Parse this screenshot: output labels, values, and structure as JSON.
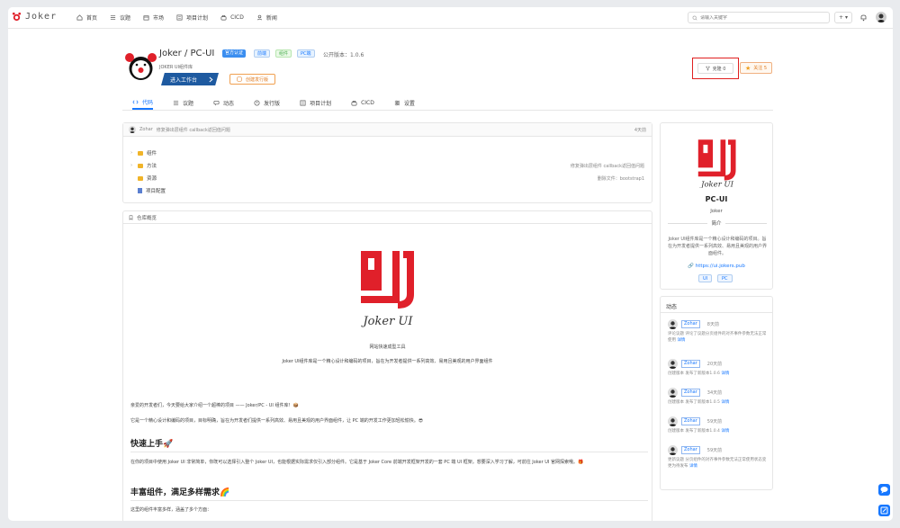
{
  "app": {
    "name": "Joker"
  },
  "nav": [
    {
      "label": "首页",
      "icon": "home-icon"
    },
    {
      "label": "议题",
      "icon": "list-icon"
    },
    {
      "label": "市场",
      "icon": "store-icon"
    },
    {
      "label": "项目计划",
      "icon": "plan-icon"
    },
    {
      "label": "CICD",
      "icon": "cicd-icon"
    },
    {
      "label": "新闻",
      "icon": "user-icon"
    }
  ],
  "search": {
    "placeholder": "请输入关键字"
  },
  "topbar": {
    "plus": "+ ▾"
  },
  "project": {
    "title": "Joker / PC-UI",
    "badges": [
      {
        "label": "官方认证",
        "bg": "#3b8ef0",
        "fg": "#ffffff"
      },
      {
        "label": "前端",
        "bg": "#e6f2ff",
        "fg": "#1677ff"
      },
      {
        "label": "组件",
        "bg": "#e9f9e6",
        "fg": "#4caf50"
      },
      {
        "label": "PC端",
        "bg": "#e6f2ff",
        "fg": "#1677ff"
      }
    ],
    "version": "公开版本：1.0.6",
    "desc": "JOKER UI组件库",
    "enter": "进入工作台",
    "release": "创建发行版",
    "clone": "克隆 0",
    "follow": "关注 5"
  },
  "tabs": [
    {
      "label": "代码",
      "icon": "code-icon"
    },
    {
      "label": "议题",
      "icon": "list-icon"
    },
    {
      "label": "动态",
      "icon": "chat-icon"
    },
    {
      "label": "发行版",
      "icon": "release-icon"
    },
    {
      "label": "项目计划",
      "icon": "plan-icon"
    },
    {
      "label": "CICD",
      "icon": "cicd-icon"
    },
    {
      "label": "设置",
      "icon": "settings-icon"
    }
  ],
  "commit": {
    "author": "Zohar",
    "message": "修复弹出层组件 callback返回值问题",
    "time": "4天前"
  },
  "files": [
    {
      "name": "组件",
      "type": "folder",
      "msg": ""
    },
    {
      "name": "方法",
      "type": "folder",
      "msg": "修复弹出层组件 callback返回值问题"
    },
    {
      "name": "资源",
      "type": "folder",
      "msg": "删除文件：bootstrap1"
    },
    {
      "name": "项目配置",
      "type": "config",
      "msg": ""
    }
  ],
  "readme": {
    "heading": "仓库概览",
    "logo_text": "Joker UI",
    "subtitle": "网站快速成型工具",
    "tagline": "Joker UI组件库是一个精心设计和编码的项目，旨在为开发者提供一系列高效、易用且美观的用户界面组件",
    "p1": "亲爱的开发者们，今天要给大家介绍一个超棒的项目 —— Joker/PC - UI 组件库！📦",
    "p2": "它是一个精心设计和编码的项目，目标明确，旨在为开发者们提供一系列高效、易用且美观的用户界面组件，让 PC 端的开发工作更加轻松愉快。😎",
    "h1": "快速上手🚀",
    "p3": "在你的项目中使用 Joker UI 非常简单，你既可以选择引入整个 Joker UI，也能根据实际需求仅引入部分组件。它是基于 Joker Core 前端开发框架开发的一套 PC 端 UI 框架。想要深入学习了解，可前往 Joker UI 官网探索哦。🎁",
    "h2": "丰富组件，满足多样需求🌈",
    "p4": "这里的组件丰富多样，涵盖了多个方面："
  },
  "sidebar": {
    "logo_text": "Joker UI",
    "name": "PC-UI",
    "owner": "Joker",
    "intro_title": "简介",
    "intro": "Joker UI组件库是一个精心设计和编码的项目。旨在为开发者提供一系列高效、易用且美观的用户界面组件。",
    "link": "https://ui.jokers.pub",
    "tags": [
      "UI",
      "PC"
    ]
  },
  "activity": {
    "title": "动态",
    "items": [
      {
        "user": "Zohar",
        "time": "8天前",
        "text": "评论议题 评论了议题分页组件的对齐事件参数无法正常使用",
        "link": "详情"
      },
      {
        "user": "Zohar",
        "time": "20天前",
        "text": "创建版本 发布了新版本1.0.6",
        "link": "详情"
      },
      {
        "user": "Zohar",
        "time": "34天前",
        "text": "创建版本 发布了新版本1.0.5",
        "link": "详情"
      },
      {
        "user": "Zohar",
        "time": "59天前",
        "text": "创建版本 发布了新版本1.0.4",
        "link": "详情"
      },
      {
        "user": "Zohar",
        "time": "59天前",
        "text": "更新议题 分页组件的对齐事件参数无法正常使用状态变更为待发布",
        "link": "详情"
      }
    ]
  },
  "colors": {
    "brand": "#e0202a",
    "accent": "#1677ff"
  }
}
